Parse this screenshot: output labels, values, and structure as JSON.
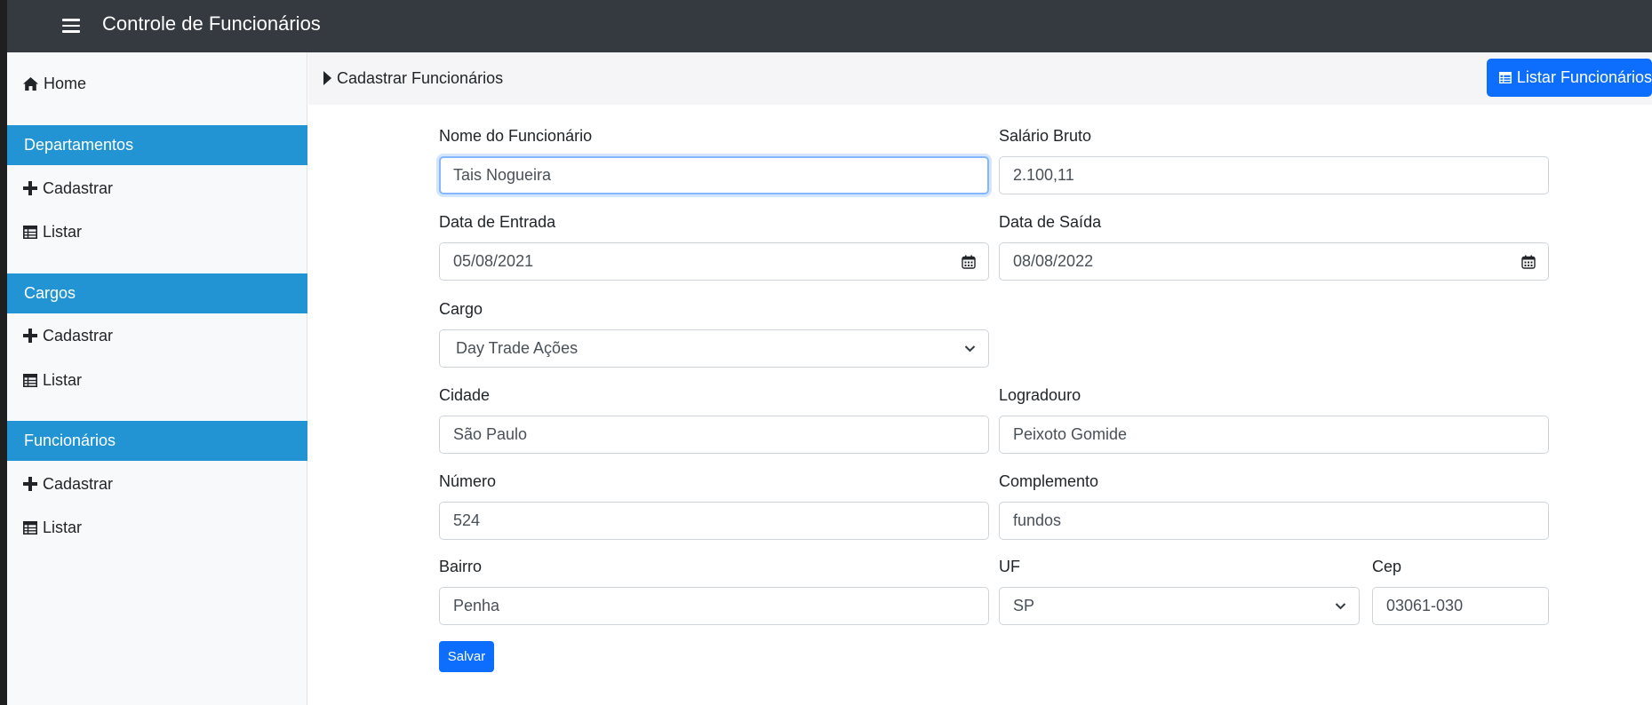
{
  "app": {
    "title": "Controle de Funcionários"
  },
  "sidebar": {
    "home": {
      "label": "Home",
      "icon": "home-icon"
    },
    "sections": [
      {
        "title": "Departamentos",
        "items": [
          {
            "label": "Cadastrar",
            "icon": "plus-icon"
          },
          {
            "label": "Listar",
            "icon": "table-icon"
          }
        ]
      },
      {
        "title": "Cargos",
        "items": [
          {
            "label": "Cadastrar",
            "icon": "plus-icon"
          },
          {
            "label": "Listar",
            "icon": "table-icon"
          }
        ]
      },
      {
        "title": "Funcionários",
        "items": [
          {
            "label": "Cadastrar",
            "icon": "plus-icon"
          },
          {
            "label": "Listar",
            "icon": "table-icon"
          }
        ]
      }
    ]
  },
  "breadcrumb": {
    "label": "Cadastrar Funcionários",
    "icon": "caret-right-icon"
  },
  "actions": {
    "list_button": "Listar Funcionários"
  },
  "colors": {
    "topbar": "#343a40",
    "sidebar_header": "#2394d3",
    "primary": "#0d6efd"
  },
  "form": {
    "nome": {
      "label": "Nome do Funcionário",
      "value": "Tais Nogueira"
    },
    "salario": {
      "label": "Salário Bruto",
      "value": "2.100,11"
    },
    "data_entrada": {
      "label": "Data de Entrada",
      "value": "05/08/2021"
    },
    "data_saida": {
      "label": "Data de Saída",
      "value": "08/08/2022"
    },
    "cargo": {
      "label": "Cargo",
      "value": "Day Trade Ações"
    },
    "cidade": {
      "label": "Cidade",
      "value": "São Paulo"
    },
    "logradouro": {
      "label": "Logradouro",
      "value": "Peixoto Gomide"
    },
    "numero": {
      "label": "Número",
      "value": "524"
    },
    "complemento": {
      "label": "Complemento",
      "value": "fundos"
    },
    "bairro": {
      "label": "Bairro",
      "value": "Penha"
    },
    "uf": {
      "label": "UF",
      "value": "SP"
    },
    "cep": {
      "label": "Cep",
      "value": "03061-030"
    },
    "submit": "Salvar"
  }
}
